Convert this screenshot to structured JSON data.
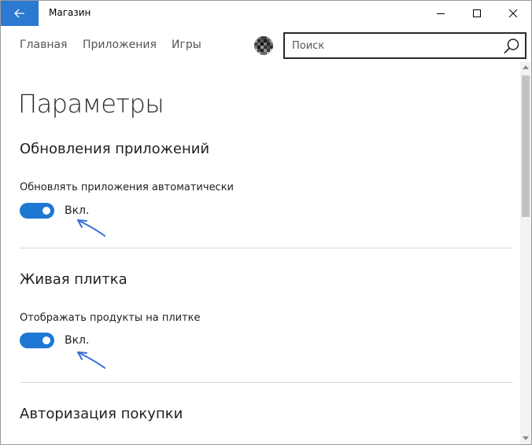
{
  "window": {
    "app_title": "Магазин"
  },
  "nav": {
    "items": [
      {
        "label": "Главная"
      },
      {
        "label": "Приложения"
      },
      {
        "label": "Игры"
      }
    ]
  },
  "search": {
    "placeholder": "Поиск"
  },
  "icons": {
    "back": "arrow-left-icon",
    "minimize": "minimize-icon",
    "maximize": "maximize-icon",
    "close": "close-icon",
    "search": "search-icon",
    "avatar": "pixelated-avatar"
  },
  "colors": {
    "accent": "#1e78d3",
    "back_button": "#2b79d0",
    "annotation_arrow": "#3a6fd8"
  },
  "page": {
    "title": "Параметры"
  },
  "sections": [
    {
      "title": "Обновления приложений",
      "setting_label": "Обновлять приложения автоматически",
      "toggle_on": true,
      "toggle_state": "Вкл."
    },
    {
      "title": "Живая плитка",
      "setting_label": "Отображать продукты на плитке",
      "toggle_on": true,
      "toggle_state": "Вкл."
    },
    {
      "title": "Авторизация покупки"
    }
  ]
}
